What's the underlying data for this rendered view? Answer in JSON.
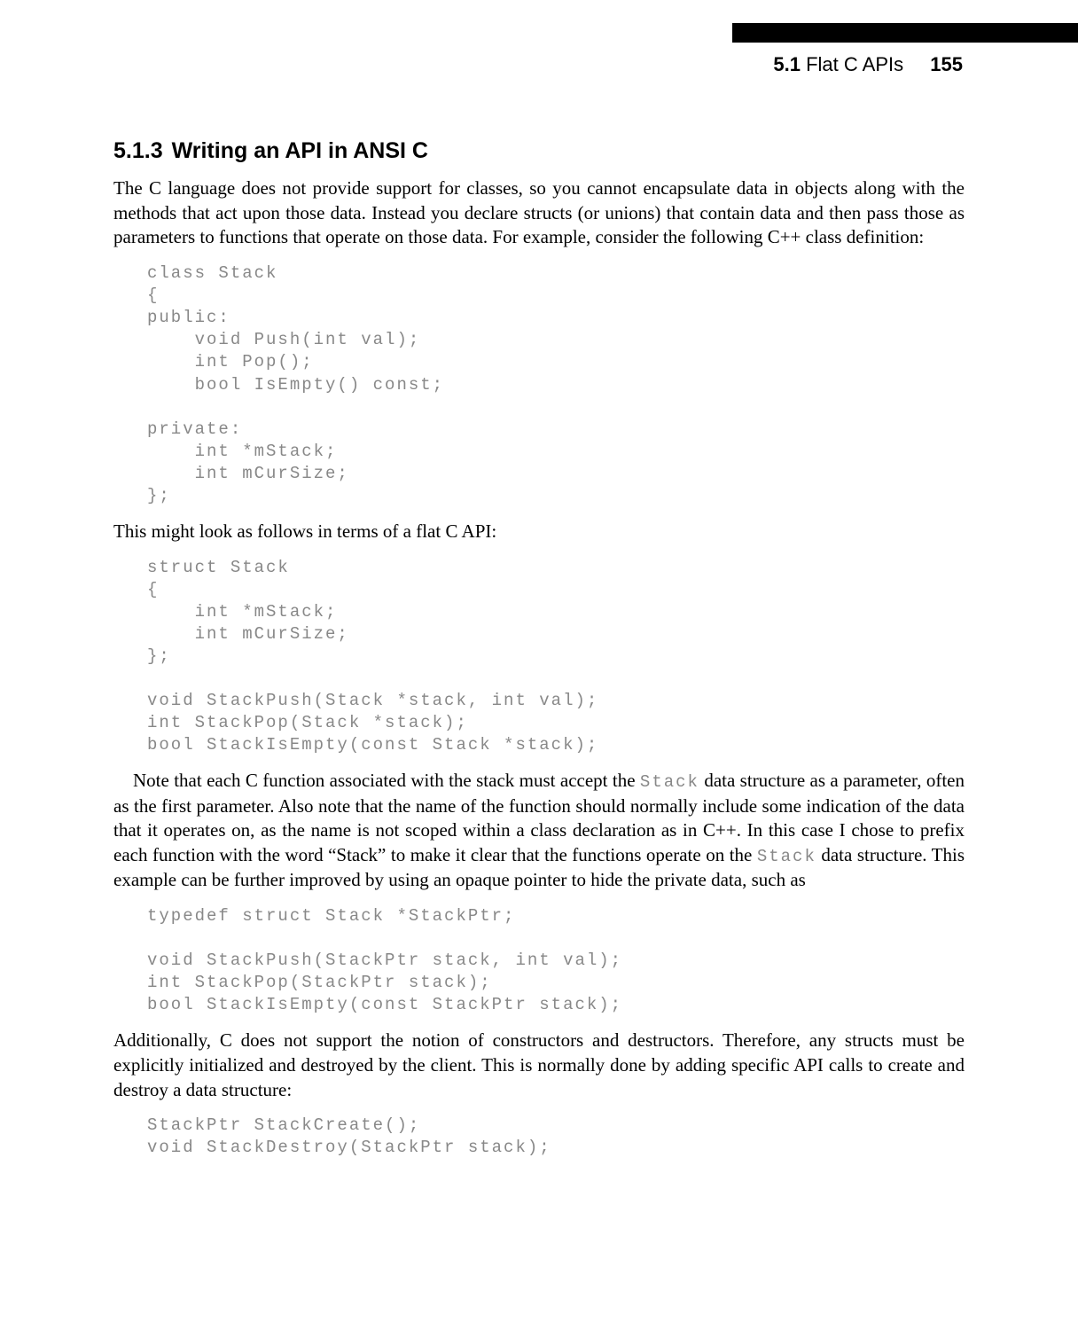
{
  "header": {
    "section_num": "5.1",
    "section_title": "Flat C APIs",
    "page_num": "155"
  },
  "heading": {
    "num": "5.1.3",
    "title": "Writing an API in ANSI C"
  },
  "para1": "The C language does not provide support for classes, so you cannot encapsulate data in objects along with the methods that act upon those data. Instead you declare structs (or unions) that contain data and then pass those as parameters to functions that operate on those data. For example, consider the following C++ class definition:",
  "code1": "class Stack\n{\npublic:\n    void Push(int val);\n    int Pop();\n    bool IsEmpty() const;\n\nprivate:\n    int *mStack;\n    int mCurSize;\n};",
  "para2": "This might look as follows in terms of a flat C API:",
  "code2": "struct Stack\n{\n    int *mStack;\n    int mCurSize;\n};\n\nvoid StackPush(Stack *stack, int val);\nint StackPop(Stack *stack);\nbool StackIsEmpty(const Stack *stack);",
  "para3_a": "Note that each C function associated with the stack must accept the ",
  "para3_code1": "Stack",
  "para3_b": " data structure as a parameter, often as the first parameter. Also note that the name of the function should normally include some indication of the data that it operates on, as the name is not scoped within a class declaration as in C++. In this case I chose to prefix each function with the word “Stack” to make it clear that the functions operate on the ",
  "para3_code2": "Stack",
  "para3_c": " data structure. This example can be further improved by using an opaque pointer to hide the private data, such as",
  "code3": "typedef struct Stack *StackPtr;\n\nvoid StackPush(StackPtr stack, int val);\nint StackPop(StackPtr stack);\nbool StackIsEmpty(const StackPtr stack);",
  "para4": "Additionally, C does not support the notion of constructors and destructors. Therefore, any structs must be explicitly initialized and destroyed by the client. This is normally done by adding specific API calls to create and destroy a data structure:",
  "code4": "StackPtr StackCreate();\nvoid StackDestroy(StackPtr stack);"
}
